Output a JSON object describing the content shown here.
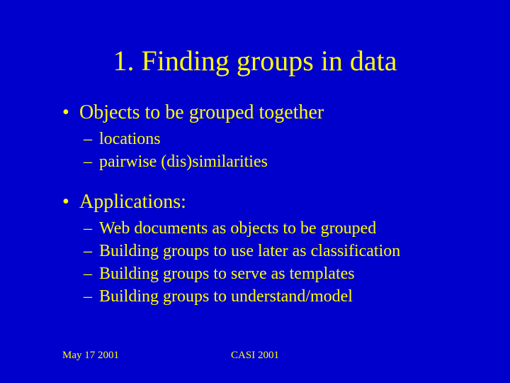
{
  "title": "1. Finding groups in data",
  "bullets": [
    {
      "text": "Objects to be grouped together",
      "sub": [
        "locations",
        "pairwise (dis)similarities"
      ]
    },
    {
      "text": "Applications:",
      "sub": [
        "Web documents as objects to be grouped",
        "Building groups to use later as classification",
        "Building groups to serve as templates",
        "Building groups to understand/model"
      ]
    }
  ],
  "footer": {
    "date": "May 17 2001",
    "event": "CASI 2001"
  }
}
